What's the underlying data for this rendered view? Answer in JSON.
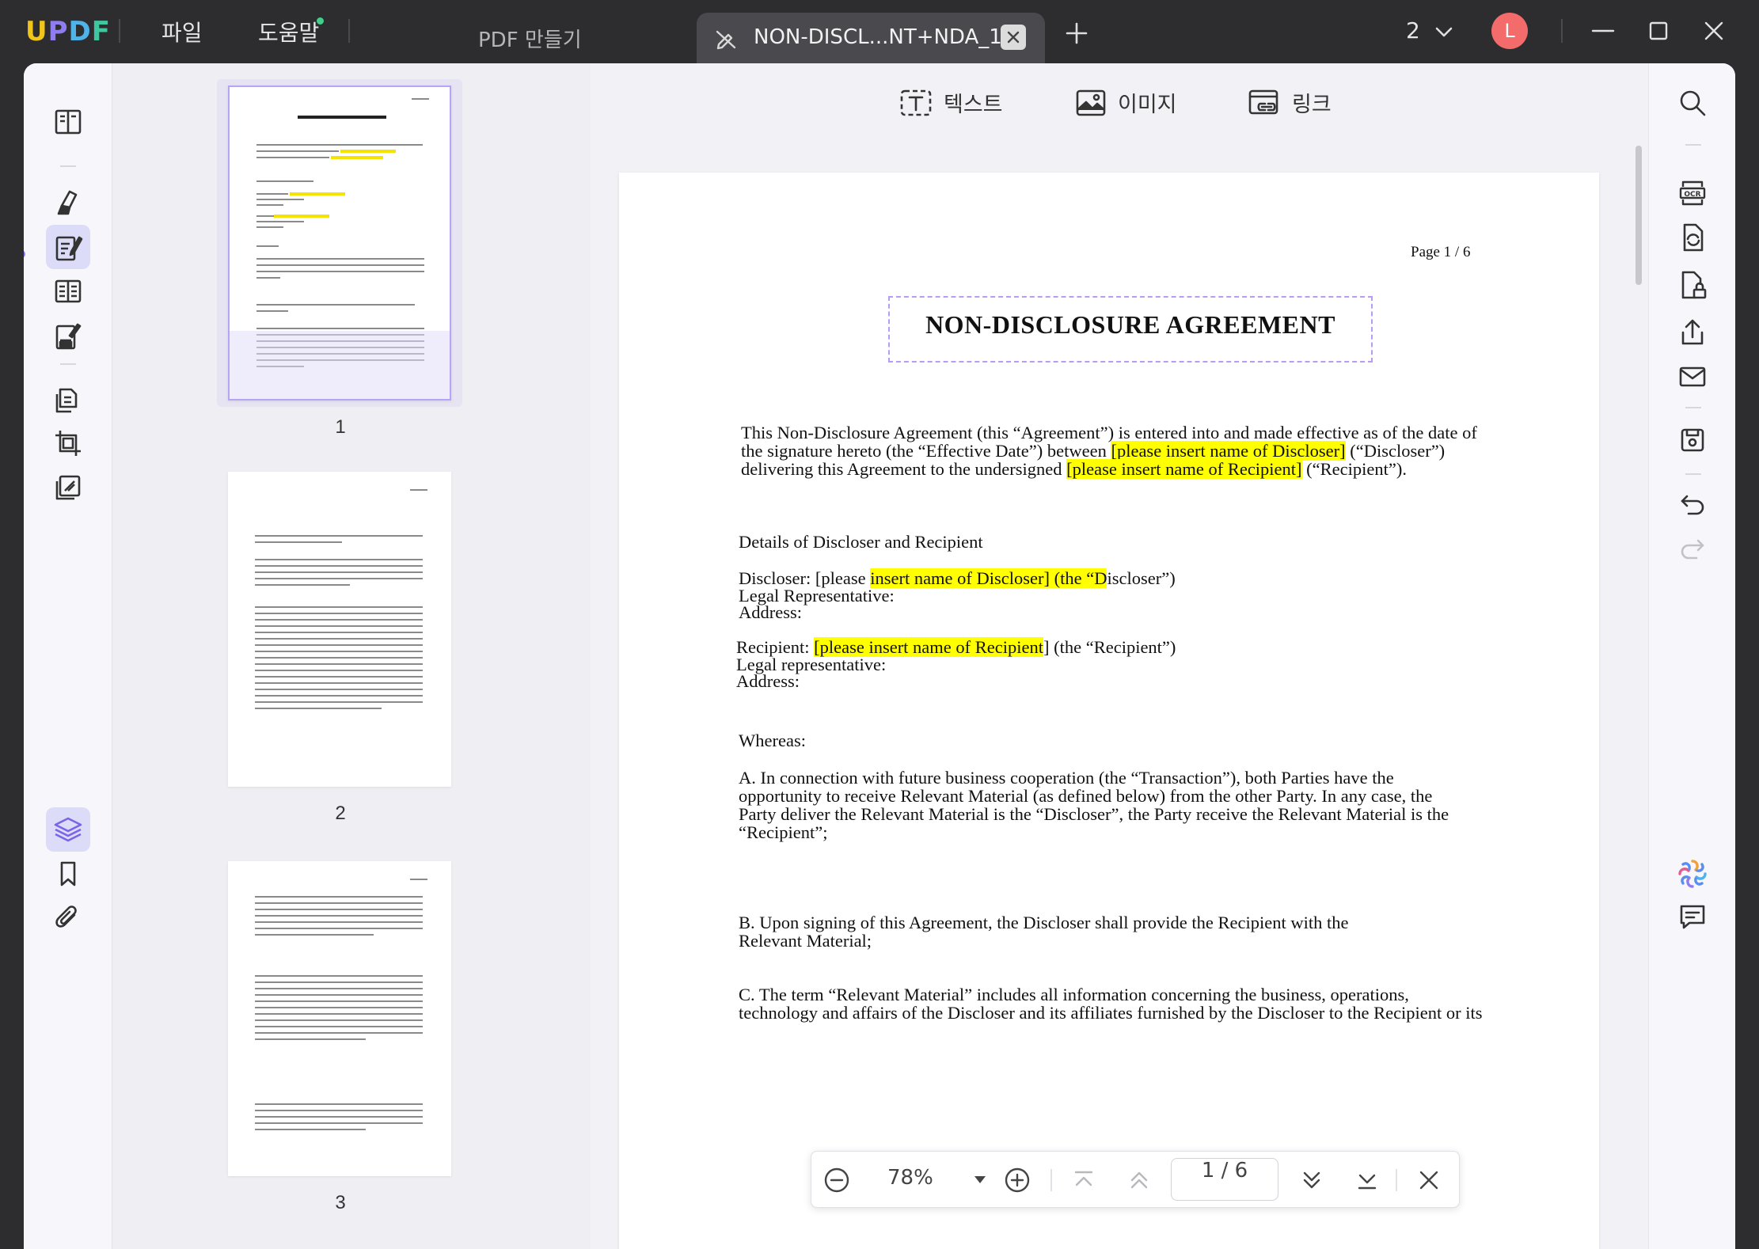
{
  "app": {
    "logo": "UPDF",
    "menu": {
      "file": "파일",
      "help": "도움말"
    },
    "tabs": [
      {
        "label": "PDF 만들기"
      },
      {
        "label": "NON-DISCL...NT+NDA_1*"
      }
    ],
    "window_count": "2",
    "avatar_letter": "L"
  },
  "toolbar": {
    "text": "텍스트",
    "image": "이미지",
    "link": "링크"
  },
  "thumbnails": [
    {
      "number": "1",
      "page_label": "Page 1 / 6",
      "title": "NON-DISCLOSURE AGREEMENT"
    },
    {
      "number": "2",
      "page_label": "Page 2 / 6"
    },
    {
      "number": "3",
      "page_label": "Page 3 / 6"
    }
  ],
  "document": {
    "page_label": "Page  1  /  6",
    "title": "NON-DISCLOSURE AGREEMENT",
    "intro": {
      "l1": "This Non-Disclosure Agreement (this “Agreement”) is entered into and made effective as of the date of",
      "l2a": "the signature hereto (the “Effective Date”) between ",
      "l2b": "[please insert name of Discloser]",
      "l2c": " (“Discloser”)",
      "l3a": "delivering this Agreement to the undersigned ",
      "l3b": "[please insert name of Recipient]",
      "l3c": " (“Recipient”)."
    },
    "details_heading": "Details of Discloser and Recipient",
    "discloser": {
      "a": "Discloser: [please ",
      "b": "insert name of Discloser] (the “D",
      "c": "iscloser”)",
      "legal": " Legal Representative:",
      "address": "Address:"
    },
    "recipient": {
      "a": "Recipient: ",
      "b": "[please insert name of Recipient",
      "c": "] (the “Recipient”)",
      "legal": "Legal representative:",
      "address": "Address:"
    },
    "whereas": "Whereas:",
    "clause_a": [
      "A. In connection with future business cooperation (the “Transaction”), both Parties have the",
      "opportunity to receive Relevant Material (as defined below) from the other Party. In any case, the",
      "Party deliver the Relevant Material is the “Discloser”, the Party receive the Relevant Material is the",
      "“Recipient”;"
    ],
    "clause_b": [
      "B. Upon signing of this Agreement, the Discloser shall provide the Recipient with the",
      "Relevant Material;"
    ],
    "clause_c": [
      "C. The term “Relevant Material” includes all information concerning the business, operations,",
      "technology and affairs of the Discloser and its affiliates furnished by the Discloser to the Recipient or its"
    ]
  },
  "navbar": {
    "zoom": "78%",
    "page": "1 / 6"
  },
  "colors": {
    "accent": "#8e7cf0",
    "highlight": "#ffff00",
    "titlebar": "#2d2d30",
    "avatar": "#f46b6b"
  }
}
